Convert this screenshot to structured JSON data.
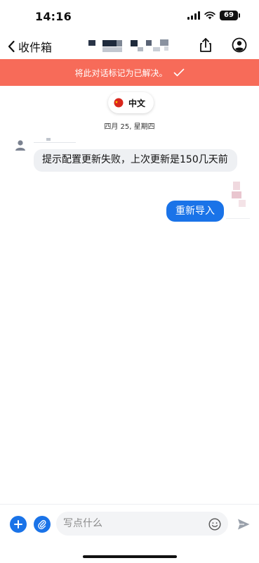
{
  "status_bar": {
    "time": "14:16",
    "battery": "69"
  },
  "nav": {
    "back_label": "收件箱",
    "back_icon": "chevron-left-icon",
    "share_icon": "share-icon",
    "profile_icon": "user-circle-icon"
  },
  "banner": {
    "text": "将此对话标记为已解决。",
    "icon": "check-icon",
    "color": "#f76b59"
  },
  "language": {
    "label": "中文",
    "icon": "flag-icon"
  },
  "date_label": "四月 25, 星期四",
  "messages": [
    {
      "direction": "incoming",
      "text": "提示配置更新失败，上次更新是150几天前"
    },
    {
      "direction": "outgoing",
      "text": "重新导入"
    }
  ],
  "composer": {
    "placeholder": "写点什么",
    "add_icon": "plus-icon",
    "attach_icon": "paperclip-icon",
    "emoji_icon": "smiley-icon",
    "send_icon": "send-icon"
  },
  "colors": {
    "accent": "#1a73e8",
    "banner": "#f76b59",
    "incoming_bubble": "#eef0f3"
  }
}
